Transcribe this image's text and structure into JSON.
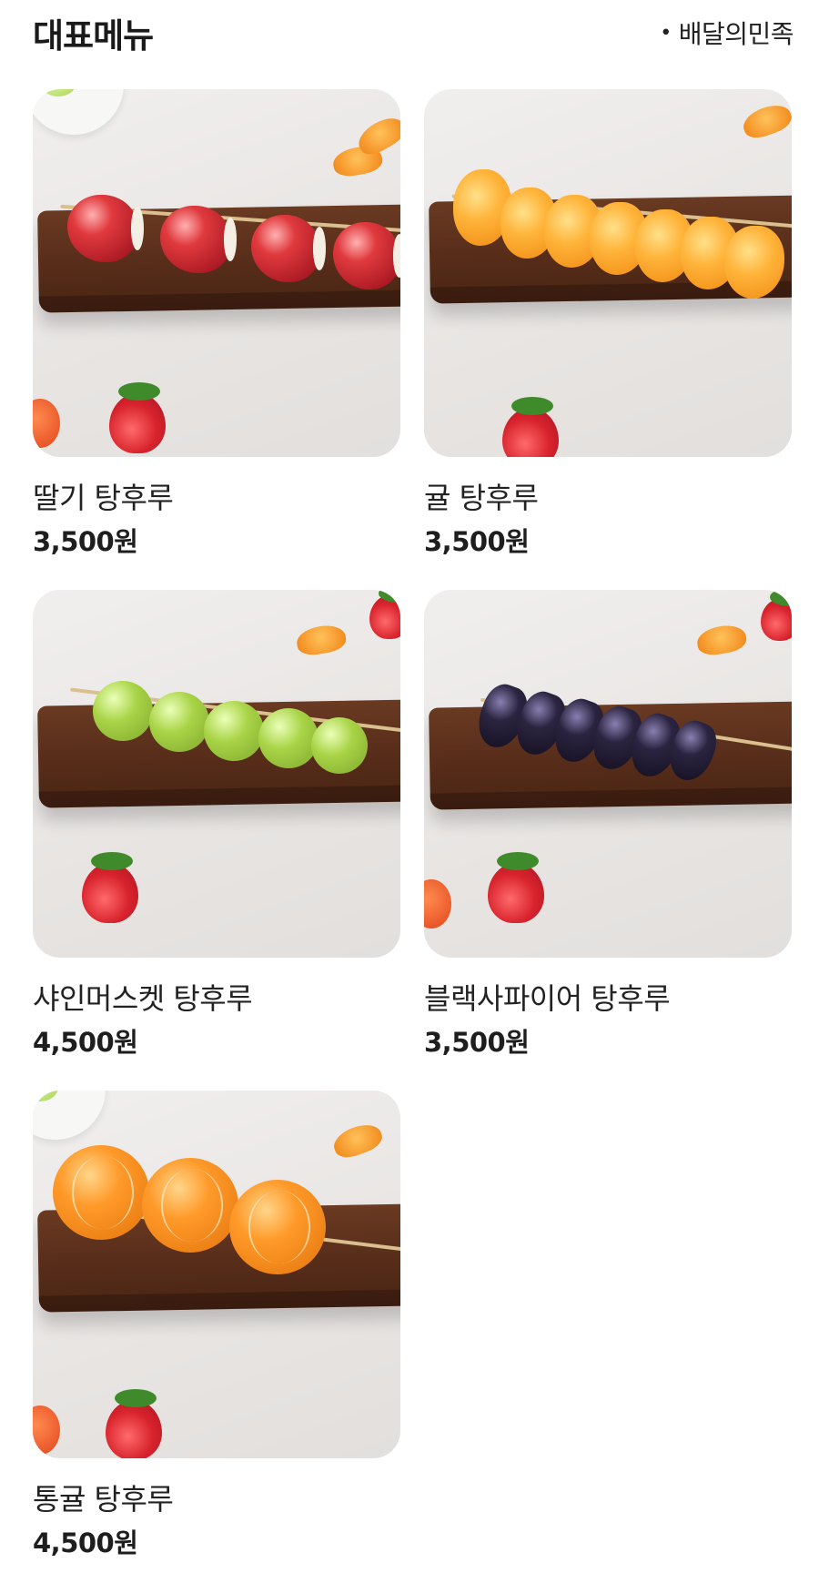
{
  "header": {
    "title": "대표메뉴",
    "source_bullet": "•",
    "source": "배달의민족"
  },
  "menu": [
    {
      "name": "딸기 탕후루",
      "price": "3,500원",
      "image_icon": "strawberry-tanghulu-image"
    },
    {
      "name": "귤 탕후루",
      "price": "3,500원",
      "image_icon": "tangerine-tanghulu-image"
    },
    {
      "name": "샤인머스켓 탕후루",
      "price": "4,500원",
      "image_icon": "shine-muscat-tanghulu-image"
    },
    {
      "name": "블랙사파이어 탕후루",
      "price": "3,500원",
      "image_icon": "black-sapphire-tanghulu-image"
    },
    {
      "name": "통귤 탕후루",
      "price": "4,500원",
      "image_icon": "whole-tangerine-tanghulu-image"
    }
  ],
  "colors": {
    "background": "#ffffff",
    "text": "#1a1a1a",
    "board": "#5a2f1b"
  }
}
